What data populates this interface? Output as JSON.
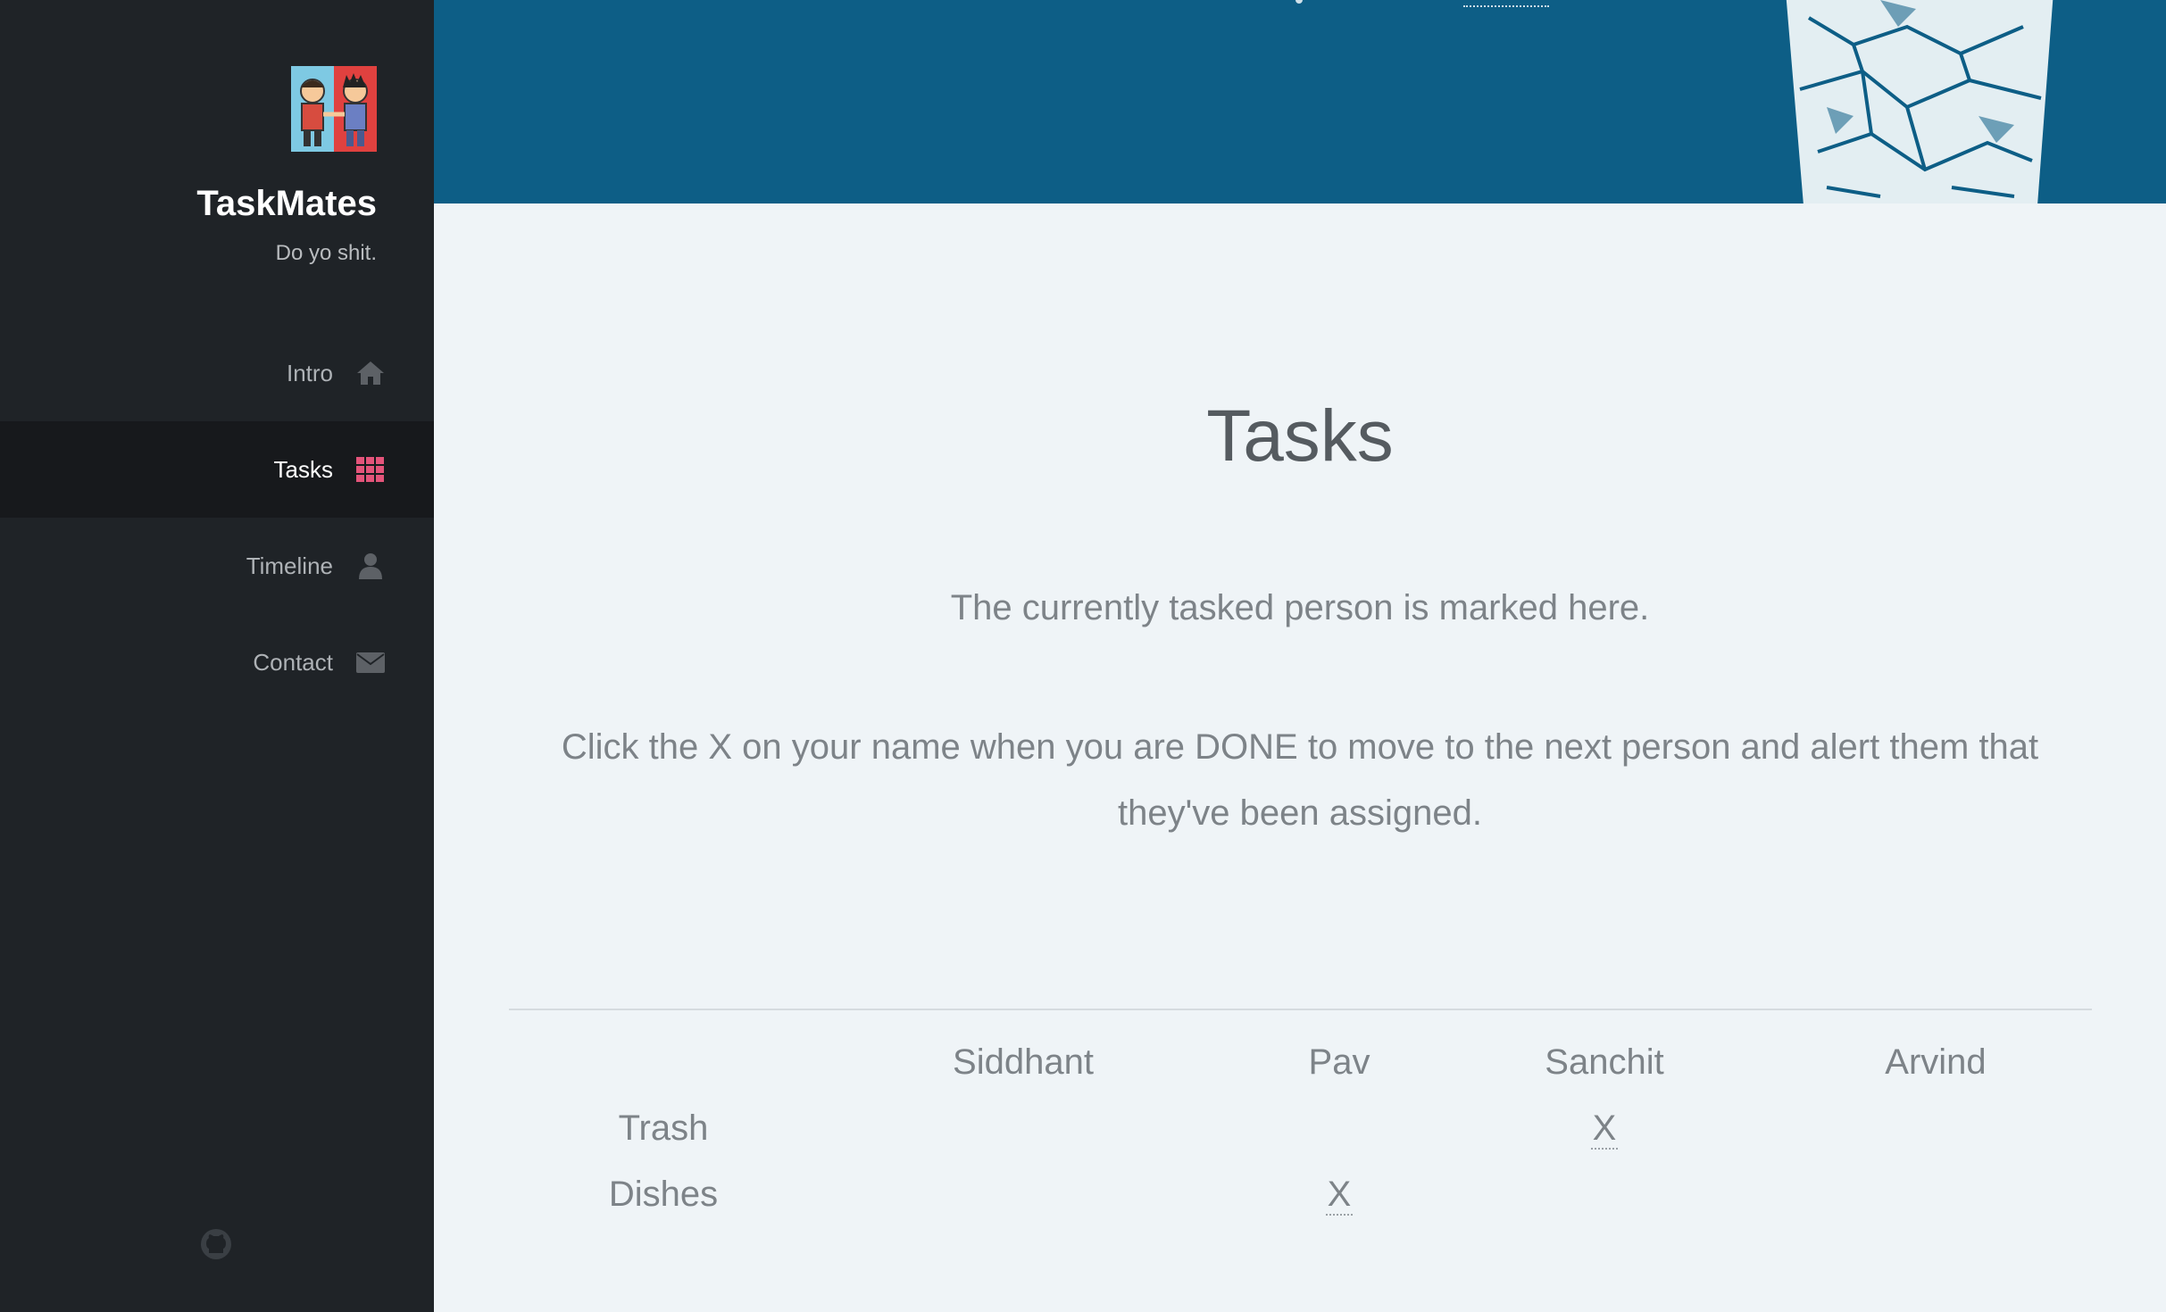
{
  "sidebar": {
    "brand": "TaskMates",
    "tagline": "Do yo shit.",
    "nav": [
      {
        "label": "Intro",
        "icon": "home-icon",
        "active": false
      },
      {
        "label": "Tasks",
        "icon": "grid-icon",
        "active": true
      },
      {
        "label": "Timeline",
        "icon": "user-icon",
        "active": false
      },
      {
        "label": "Contact",
        "icon": "envelope-icon",
        "active": false
      }
    ],
    "footer_icon": "github-icon"
  },
  "main": {
    "title": "Tasks",
    "description1": "The currently tasked person is marked here.",
    "description2": "Click the X on your name when you are DONE to move to the next person and alert them that they've been assigned.",
    "table": {
      "people": [
        "Siddhant",
        "Pav",
        "Sanchit",
        "Arvind"
      ],
      "rows": [
        {
          "task": "Trash",
          "assigned": "Sanchit",
          "mark": "X"
        },
        {
          "task": "Dishes",
          "assigned": "Pav",
          "mark": "X"
        }
      ]
    }
  },
  "colors": {
    "sidebar_bg": "#1f2327",
    "active_bg": "#17191c",
    "banner": "#0d5e86",
    "content_bg": "#eff4f7",
    "accent": "#e4547a"
  }
}
